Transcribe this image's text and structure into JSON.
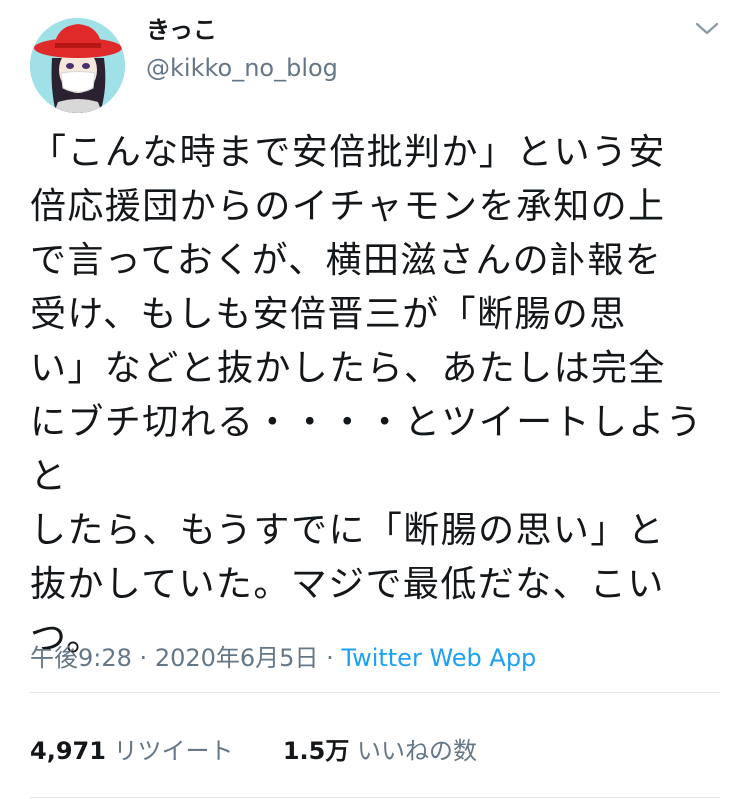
{
  "user": {
    "display_name": "きっこ",
    "handle": "@kikko_no_blog"
  },
  "icons": {
    "menu": "chevron-down-icon",
    "avatar": "avatar"
  },
  "tweet": {
    "text": "「こんな時まで安倍批判か」という安\n倍応援団からのイチャモンを承知の上\nで言っておくが、横田滋さんの訃報を\n受け、もしも安倍晋三が「断腸の思\nい」などと抜かしたら、あたしは完全\nにブチ切れる・・・・とツイートしようと\nしたら、もうすでに「断腸の思い」と\n抜かしていた。マジで最低だな、こい\nつ。",
    "time": "午後9:28",
    "date": "2020年6月5日",
    "separator": "·",
    "source": "Twitter Web App"
  },
  "stats": {
    "retweets_count": "4,971",
    "retweets_label": "リツイート",
    "likes_count": "1.5万",
    "likes_label": "いいねの数"
  },
  "colors": {
    "accent": "#1da1f2",
    "secondary_text": "#657786",
    "divider": "#e1e8ed"
  }
}
